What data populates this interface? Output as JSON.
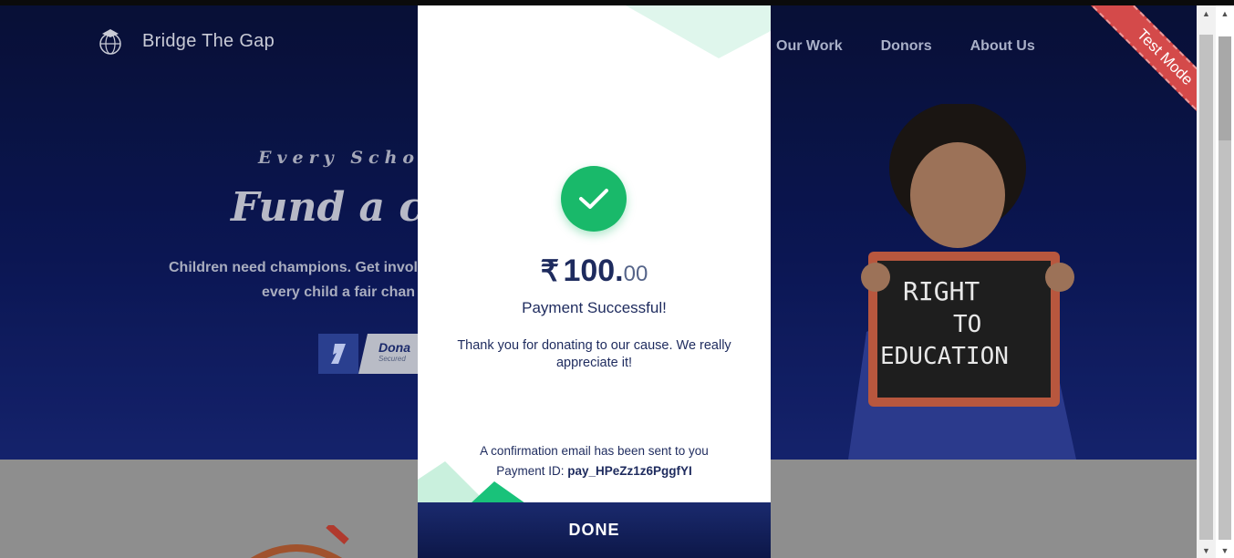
{
  "site": {
    "brand_name": "Bridge The Gap",
    "nav": [
      "Our Work",
      "Donors",
      "About Us"
    ],
    "eyebrow": "Every School",
    "headline": "Fund a chil",
    "sub_line1": "Children need champions. Get invol",
    "sub_line2": "every child a fair chan",
    "donate_label": "Dona",
    "donate_sub": "Secured",
    "ribbon": "Test Mode",
    "chalkboard_lines": [
      "RIGHT",
      "TO",
      "EDUCATION"
    ]
  },
  "modal": {
    "currency": "₹",
    "amount_int": "100.",
    "amount_dec": "00",
    "status": "Payment Successful!",
    "thanks": "Thank you for donating to our cause. We really appreciate it!",
    "email_note": "A confirmation email has been sent to you",
    "payment_id_label": "Payment ID:",
    "payment_id": "pay_HPeZz1z6PggfYI",
    "done_label": "DONE"
  },
  "colors": {
    "success": "#19b96a",
    "navy": "#1e2b5e",
    "ribbon": "#d44a4a"
  }
}
